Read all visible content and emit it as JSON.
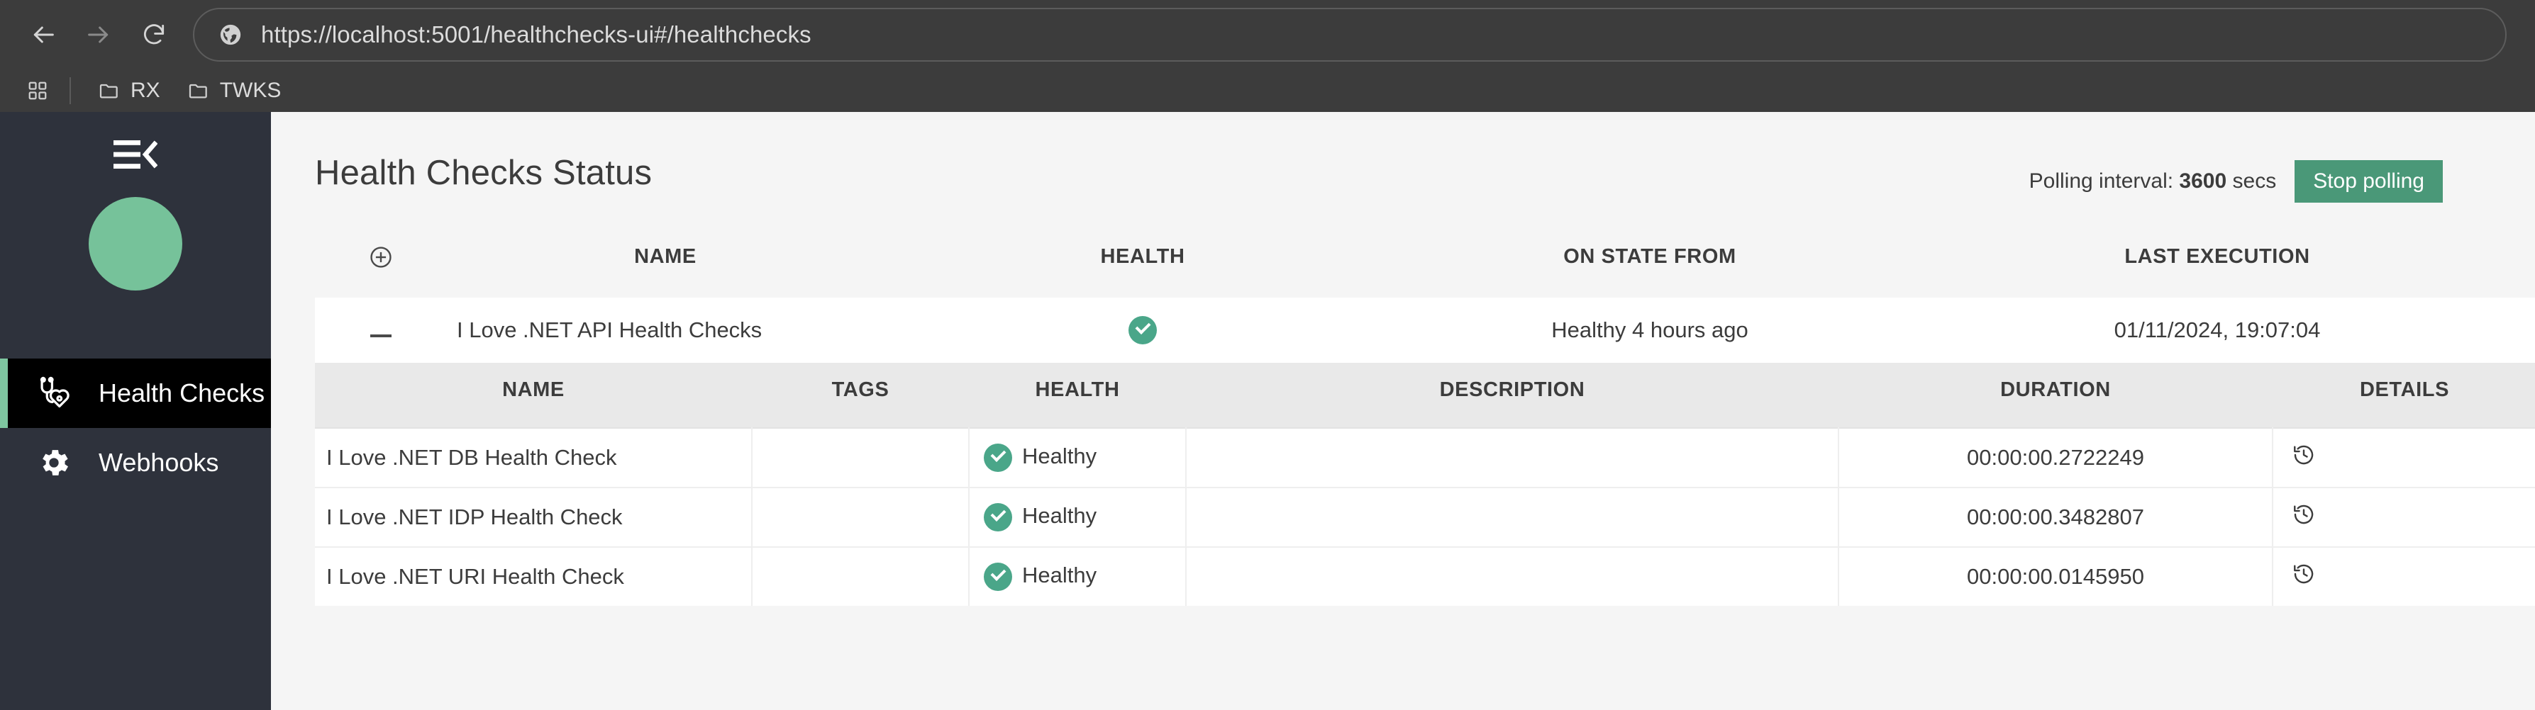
{
  "browser": {
    "back_icon": "back-arrow-icon",
    "forward_icon": "forward-arrow-icon",
    "reload_icon": "reload-icon",
    "site_icon": "globe-icon",
    "url": "https://localhost:5001/healthchecks-ui#/healthchecks",
    "url_placeholder": "Search or type a URL",
    "bookmarks": [
      {
        "label": "RX",
        "icon": "folder-icon"
      },
      {
        "label": "TWKS",
        "icon": "folder-icon"
      }
    ],
    "apps_icon": "apps-grid-icon"
  },
  "sidebar": {
    "collapse_icon": "menu-collapse-icon",
    "avatar_color": "#76c29a",
    "active_accent_color": "#7ec6a0",
    "items": [
      {
        "label": "Health Checks",
        "icon": "stethoscope-heart-icon",
        "active": true
      },
      {
        "label": "Webhooks",
        "icon": "gear-icon",
        "active": false
      }
    ]
  },
  "main": {
    "title": "Health Checks Status",
    "polling_label": "Polling interval:",
    "polling_value": "3600",
    "polling_unit": "secs",
    "stop_polling_label": "Stop polling",
    "stop_polling_color": "#4a9878"
  },
  "outer_table": {
    "headers": {
      "toggle_icon": "plus-circle-icon",
      "name": "NAME",
      "health": "HEALTH",
      "on_state_from": "ON STATE FROM",
      "last_execution": "LAST EXECUTION"
    },
    "row": {
      "toggle_icon": "minus-icon",
      "name": "I Love .NET API Health Checks",
      "health_icon": "check-circle-icon",
      "on_state_from": "Healthy 4 hours ago",
      "last_execution": "01/11/2024, 19:07:04"
    }
  },
  "inner_table": {
    "headers": {
      "name": "NAME",
      "tags": "TAGS",
      "health": "HEALTH",
      "description": "DESCRIPTION",
      "duration": "DURATION",
      "details": "DETAILS"
    },
    "rows": [
      {
        "name": "I Love .NET DB Health Check",
        "tags": "",
        "health": "Healthy",
        "health_icon": "check-circle-icon",
        "description": "",
        "duration": "00:00:00.2722249",
        "details_icon": "history-clock-icon"
      },
      {
        "name": "I Love .NET IDP Health Check",
        "tags": "",
        "health": "Healthy",
        "health_icon": "check-circle-icon",
        "description": "",
        "duration": "00:00:00.3482807",
        "details_icon": "history-clock-icon"
      },
      {
        "name": "I Love .NET URI Health Check",
        "tags": "",
        "health": "Healthy",
        "health_icon": "check-circle-icon",
        "description": "",
        "duration": "00:00:00.0145950",
        "details_icon": "history-clock-icon"
      }
    ]
  }
}
